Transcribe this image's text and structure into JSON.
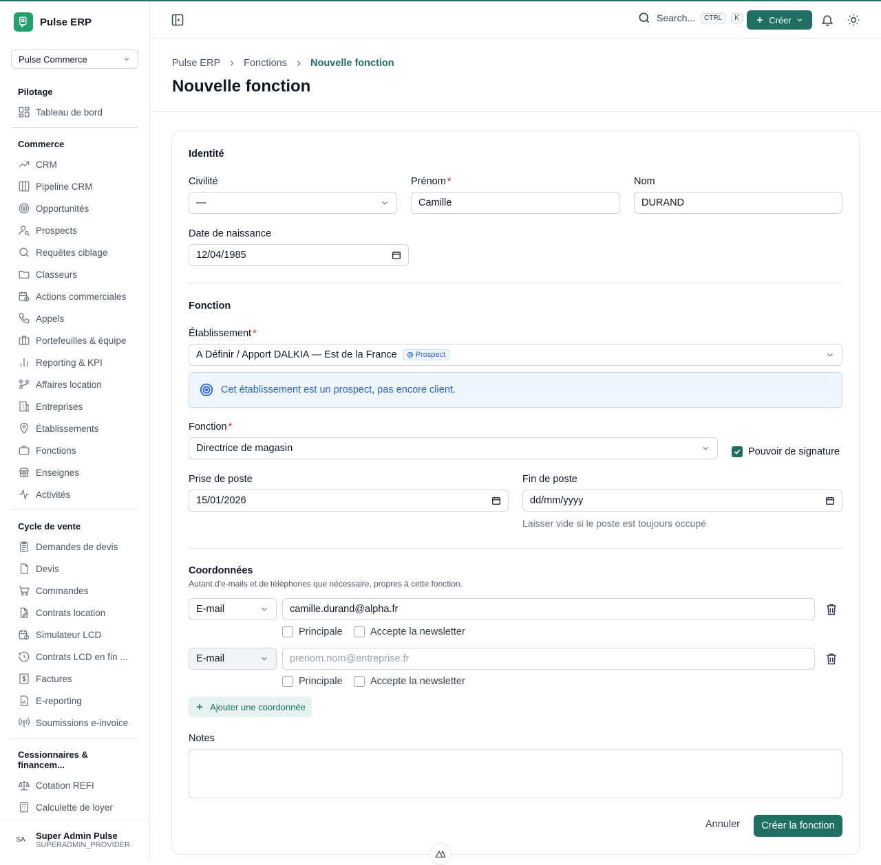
{
  "app": {
    "name": "Pulse ERP"
  },
  "org_select": {
    "value": "Pulse Commerce"
  },
  "sidebar": {
    "groups": [
      {
        "title": "Pilotage",
        "items": [
          {
            "label": "Tableau de bord",
            "icon": "dashboard-icon"
          }
        ]
      },
      {
        "title": "Commerce",
        "items": [
          {
            "label": "CRM",
            "icon": "trend-icon"
          },
          {
            "label": "Pipeline CRM",
            "icon": "columns-icon"
          },
          {
            "label": "Opportunités",
            "icon": "target-icon"
          },
          {
            "label": "Prospects",
            "icon": "user-search-icon"
          },
          {
            "label": "Requêtes ciblage",
            "icon": "search-icon"
          },
          {
            "label": "Classeurs",
            "icon": "folder-icon"
          },
          {
            "label": "Actions commerciales",
            "icon": "calendar-clock-icon"
          },
          {
            "label": "Appels",
            "icon": "phone-icon"
          },
          {
            "label": "Portefeuilles & équipe",
            "icon": "briefcase-icon"
          },
          {
            "label": "Reporting & KPI",
            "icon": "bar-chart-icon"
          },
          {
            "label": "Affaires location",
            "icon": "git-branch-icon"
          },
          {
            "label": "Entreprises",
            "icon": "building-icon"
          },
          {
            "label": "Établissements",
            "icon": "map-pin-icon"
          },
          {
            "label": "Fonctions",
            "icon": "briefcase-icon"
          },
          {
            "label": "Enseignes",
            "icon": "store-icon"
          },
          {
            "label": "Activités",
            "icon": "activity-icon"
          }
        ]
      },
      {
        "title": "Cycle de vente",
        "items": [
          {
            "label": "Demandes de devis",
            "icon": "clipboard-icon"
          },
          {
            "label": "Devis",
            "icon": "document-icon"
          },
          {
            "label": "Commandes",
            "icon": "cart-icon"
          },
          {
            "label": "Contrats location",
            "icon": "file-edit-icon"
          },
          {
            "label": "Simulateur LCD",
            "icon": "calendar-clock-icon"
          },
          {
            "label": "Contrats LCD en fin ...",
            "icon": "history-icon"
          },
          {
            "label": "Factures",
            "icon": "dollar-icon"
          },
          {
            "label": "E-reporting",
            "icon": "file-chart-icon"
          },
          {
            "label": "Soumissions e-invoice",
            "icon": "broadcast-icon"
          }
        ]
      },
      {
        "title": "Cessionnaires & financem...",
        "items": [
          {
            "label": "Cotation REFI",
            "icon": "scale-icon"
          },
          {
            "label": "Calculette de loyer",
            "icon": "calculator-icon"
          }
        ]
      }
    ]
  },
  "user": {
    "initials": "SA",
    "name": "Super Admin Pulse",
    "role": "SUPERADMIN_PROVIDER"
  },
  "topbar": {
    "search_label": "Search...",
    "kbd_ctrl": "CTRL",
    "kbd_k": "K",
    "create_label": "Créer"
  },
  "breadcrumb": [
    "Pulse ERP",
    "Fonctions",
    "Nouvelle fonction"
  ],
  "page_title": "Nouvelle fonction",
  "form": {
    "identity": {
      "title": "Identité",
      "civilite_label": "Civilité",
      "civilite_value": "—",
      "prenom_label": "Prénom",
      "prenom_value": "Camille",
      "nom_label": "Nom",
      "nom_value": "DURAND",
      "birth_label": "Date de naissance",
      "birth_value": "12/04/1985"
    },
    "function": {
      "title": "Fonction",
      "etab_label": "Établissement",
      "etab_value": "A Définir / Apport DALKIA — Est de la France",
      "etab_badge": "Prospect",
      "info": "Cet établissement est un prospect, pas encore client.",
      "fonction_label": "Fonction",
      "fonction_value": "Directrice de magasin",
      "signature_label": "Pouvoir de signature",
      "signature_checked": true,
      "start_label": "Prise de poste",
      "start_value": "15/01/2026",
      "end_label": "Fin de poste",
      "end_placeholder": "dd/mm/yyyy",
      "end_hint": "Laisser vide si le poste est toujours occupé"
    },
    "contacts": {
      "title": "Coordonnées",
      "subtitle": "Autant d'e-mails et de téléphones que nécessaire, propres à cette fonction.",
      "rows": [
        {
          "type": "E-mail",
          "value": "camille.durand@alpha.fr",
          "principal": "Principale",
          "newsletter": "Accepte la newsletter"
        },
        {
          "type": "E-mail",
          "placeholder": "prenom.nom@entreprise.fr",
          "principal": "Principale",
          "newsletter": "Accepte la newsletter"
        }
      ],
      "add_label": "Ajouter une coordonnée"
    },
    "notes_label": "Notes",
    "cancel_label": "Annuler",
    "submit_label": "Créer la fonction"
  },
  "colors": {
    "accent": "#1f6f63",
    "info": "#2563eb",
    "required": "#dc2626"
  }
}
